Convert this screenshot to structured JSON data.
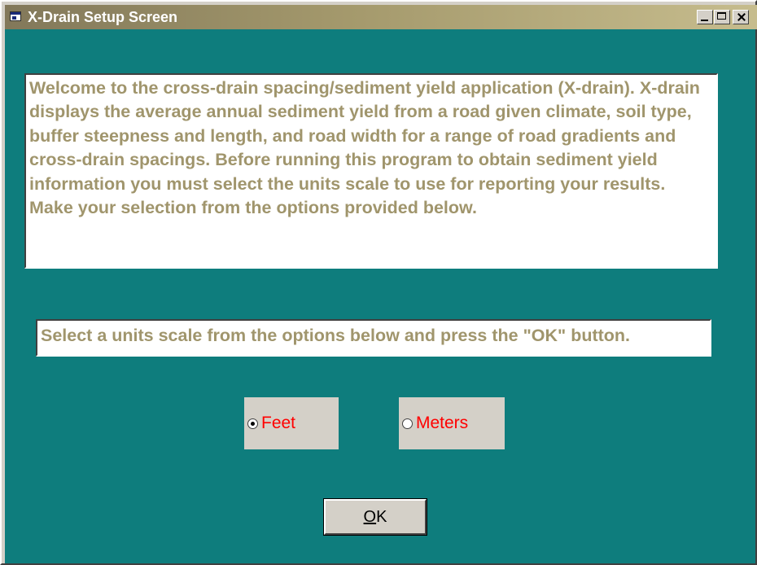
{
  "window": {
    "title": "X-Drain Setup Screen"
  },
  "welcome": {
    "text": "Welcome to the cross-drain spacing/sediment yield application (X-drain).  X-drain displays the average annual sediment yield from a road given climate, soil type, buffer steepness and length, and road width for a range of road gradients and cross-drain spacings. Before running this program to obtain sediment yield information you must select the units scale to use for reporting your results.  Make your selection from the options provided below."
  },
  "instruction": {
    "text": "Select a units scale from the options below and press the \"OK\" button."
  },
  "units": {
    "options": [
      {
        "label": "Feet",
        "selected": true
      },
      {
        "label": "Meters",
        "selected": false
      }
    ]
  },
  "ok_button": {
    "mnemonic": "O",
    "rest": "K"
  },
  "colors": {
    "background": "#0e7d7d",
    "text_tan": "#a0956c",
    "radio_label": "#ff0000"
  },
  "icons": [
    "window-app-icon",
    "minimize-icon",
    "maximize-icon",
    "close-icon"
  ]
}
